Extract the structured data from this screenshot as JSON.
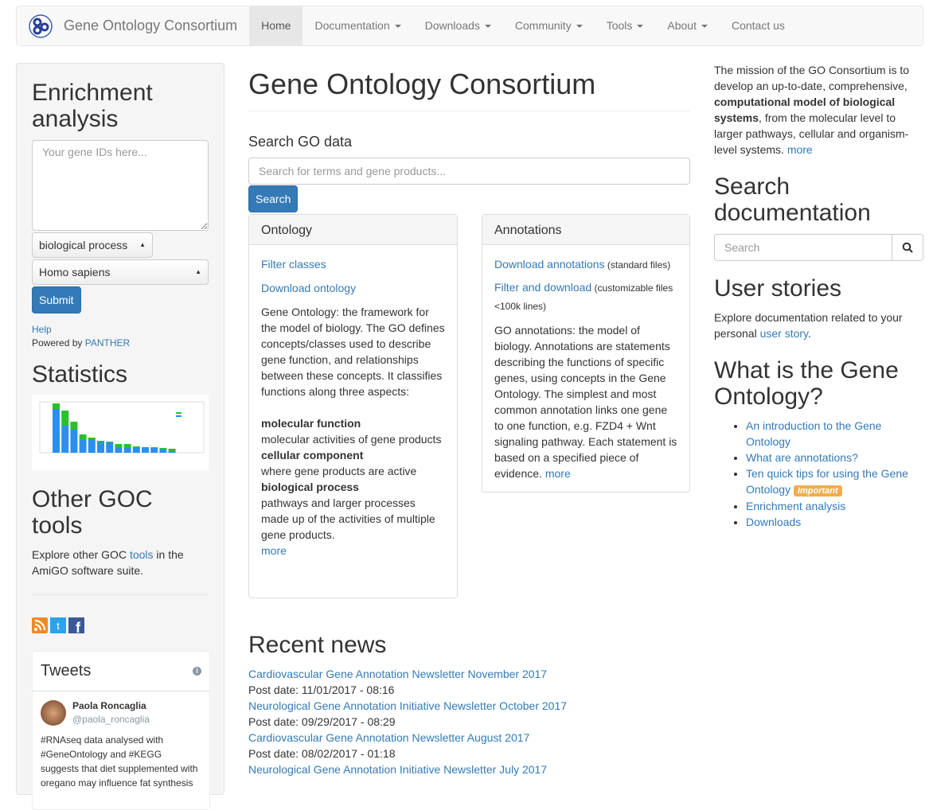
{
  "nav": {
    "brand": "Gene Ontology Consortium",
    "items": [
      {
        "label": "Home",
        "active": true,
        "caret": false
      },
      {
        "label": "Documentation",
        "caret": true
      },
      {
        "label": "Downloads",
        "caret": true
      },
      {
        "label": "Community",
        "caret": true
      },
      {
        "label": "Tools",
        "caret": true
      },
      {
        "label": "About",
        "caret": true
      },
      {
        "label": "Contact us",
        "caret": false
      }
    ]
  },
  "sidebar": {
    "enrichment_title": "Enrichment analysis",
    "gene_ids_placeholder": "Your gene IDs here...",
    "ontology_select": "biological process",
    "species_select": "Homo sapiens",
    "submit": "Submit",
    "help": "Help",
    "powered_by": "Powered by ",
    "panther": "PANTHER",
    "statistics_title": "Statistics",
    "other_tools_title": "Other GOC tools",
    "other_tools_text_1": "Explore other GOC ",
    "other_tools_link": "tools",
    "other_tools_text_2": " in the AmiGO software suite.",
    "tweets_title": "Tweets",
    "tweet": {
      "name": "Paola Roncaglia",
      "handle": "@paola_roncaglia",
      "text": "#RNAseq data analysed with #GeneOntology and #KEGG suggests that diet supplemented with oregano may influence fat synthesis"
    },
    "colors": {
      "rss": "#f08a24",
      "twitter": "#2aa3ef",
      "facebook": "#3b5998",
      "chart_blue": "#2b8fef",
      "chart_green": "#2bbf2b"
    }
  },
  "main": {
    "title": "Gene Ontology Consortium",
    "search_label": "Search GO data",
    "search_placeholder": "Search for terms and gene products...",
    "search_button": "Search",
    "ontology": {
      "title": "Ontology",
      "link1": "Filter classes",
      "link2": "Download ontology",
      "desc": "Gene Ontology: the framework for the model of biology. The GO defines concepts/classes used to describe gene function, and relationships between these concepts. It classifies functions along three aspects:",
      "aspects": [
        {
          "name": "molecular function",
          "desc": "molecular activities of gene products"
        },
        {
          "name": "cellular component",
          "desc": "where gene products are active"
        },
        {
          "name": "biological process",
          "desc": "pathways and larger processes made up of the activities of multiple gene products."
        }
      ],
      "more": "more"
    },
    "annotations": {
      "title": "Annotations",
      "link1": "Download annotations",
      "link1_note": " (standard files)",
      "link2": "Filter and download",
      "link2_note": " (customizable files <100k lines)",
      "desc": "GO annotations: the model of biology. Annotations are statements describing the functions of specific genes, using concepts in the Gene Ontology. The simplest and most common annotation links one gene to one function, e.g. FZD4 + Wnt signaling pathway. Each statement is based on a specified piece of evidence. ",
      "more": "more"
    },
    "news_title": "Recent news",
    "news": [
      {
        "title": "Cardiovascular Gene Annotation Newsletter November 2017",
        "date": "Post date: 11/01/2017 - 08:16"
      },
      {
        "title": "Neurological Gene Annotation Initiative Newsletter October 2017",
        "date": "Post date: 09/29/2017 - 08:29"
      },
      {
        "title": "Cardiovascular Gene Annotation Newsletter August 2017",
        "date": "Post date: 08/02/2017 - 01:18"
      },
      {
        "title": "Neurological Gene Annotation Initiative Newsletter July 2017",
        "date": ""
      }
    ]
  },
  "right": {
    "mission_1": "The mission of the GO Consortium is to develop an up-to-date, comprehensive, ",
    "mission_bold": "computational model of biological systems",
    "mission_2": ", from the molecular level to larger pathways, cellular and organism-level systems. ",
    "more": "more",
    "search_doc_title": "Search documentation",
    "search_doc_placeholder": "Search",
    "user_stories_title": "User stories",
    "user_stories_text": "Explore documentation related to your personal ",
    "user_story_link": "user story",
    "what_title": "What is the Gene Ontology?",
    "links": [
      "An introduction to the Gene Ontology",
      "What are annotations?",
      "Ten quick tips for using the Gene Ontology",
      "Enrichment analysis",
      "Downloads"
    ],
    "important_badge": "Important"
  }
}
